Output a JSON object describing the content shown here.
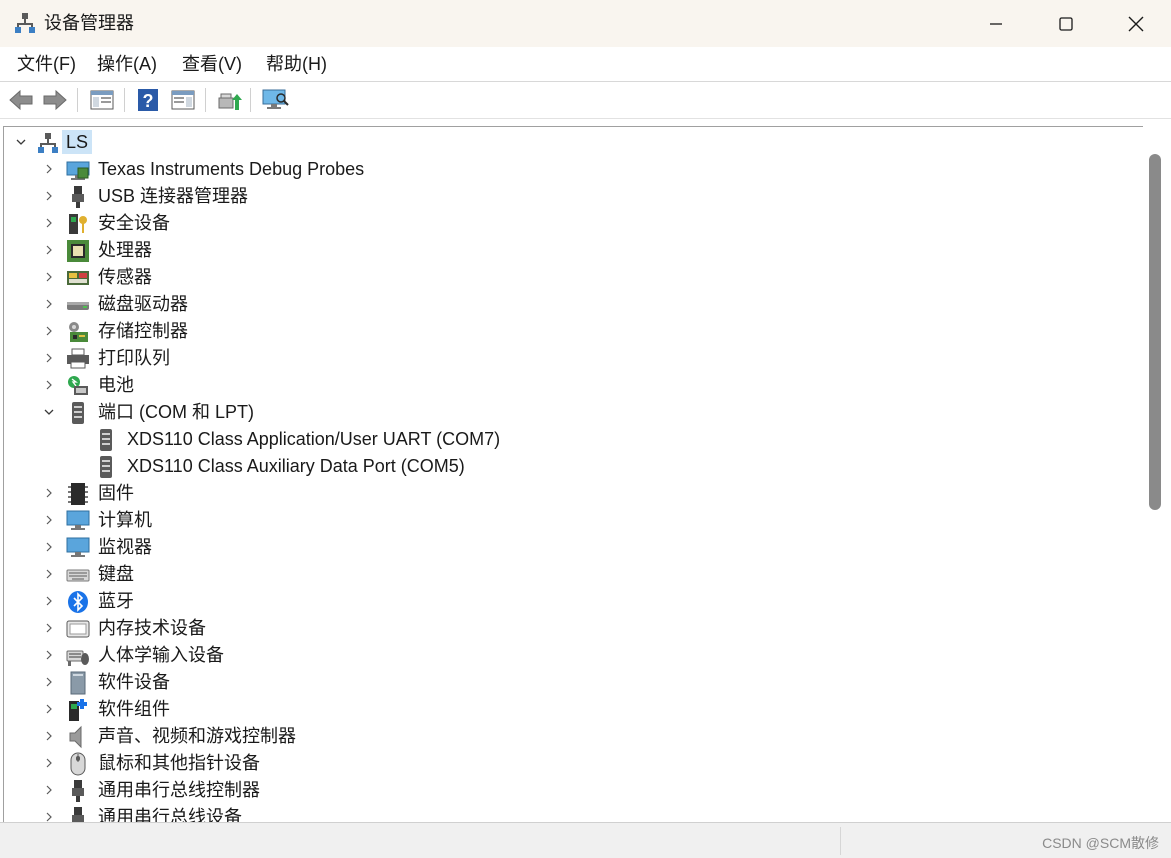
{
  "window": {
    "title": "设备管理器"
  },
  "menu": [
    "文件(F)",
    "操作(A)",
    "查看(V)",
    "帮助(H)"
  ],
  "toolbar": {
    "buttons": [
      "back-icon",
      "forward-icon",
      "show-hide-console-tree-icon",
      "help-icon",
      "properties-icon",
      "update-driver-icon",
      "scan-hardware-icon"
    ]
  },
  "tree": {
    "root": "LS",
    "items": [
      {
        "label": "Texas Instruments Debug Probes",
        "icon": "debug-probe-icon",
        "expanded": false
      },
      {
        "label": "USB 连接器管理器",
        "icon": "usb-connector-icon",
        "expanded": false
      },
      {
        "label": "安全设备",
        "icon": "security-device-icon",
        "expanded": false
      },
      {
        "label": "处理器",
        "icon": "processor-icon",
        "expanded": false
      },
      {
        "label": "传感器",
        "icon": "sensor-icon",
        "expanded": false
      },
      {
        "label": "磁盘驱动器",
        "icon": "disk-drive-icon",
        "expanded": false
      },
      {
        "label": "存储控制器",
        "icon": "storage-controller-icon",
        "expanded": false
      },
      {
        "label": "打印队列",
        "icon": "printer-icon",
        "expanded": false
      },
      {
        "label": "电池",
        "icon": "battery-icon",
        "expanded": false
      },
      {
        "label": "端口 (COM 和 LPT)",
        "icon": "port-icon",
        "expanded": true,
        "children": [
          {
            "label": "XDS110 Class Application/User UART (COM7)",
            "icon": "port-icon"
          },
          {
            "label": "XDS110 Class Auxiliary Data Port (COM5)",
            "icon": "port-icon"
          }
        ]
      },
      {
        "label": "固件",
        "icon": "firmware-icon",
        "expanded": false
      },
      {
        "label": "计算机",
        "icon": "computer-icon",
        "expanded": false
      },
      {
        "label": "监视器",
        "icon": "monitor-icon",
        "expanded": false
      },
      {
        "label": "键盘",
        "icon": "keyboard-icon",
        "expanded": false
      },
      {
        "label": "蓝牙",
        "icon": "bluetooth-icon",
        "expanded": false
      },
      {
        "label": "内存技术设备",
        "icon": "memory-device-icon",
        "expanded": false
      },
      {
        "label": "人体学输入设备",
        "icon": "hid-icon",
        "expanded": false
      },
      {
        "label": "软件设备",
        "icon": "software-device-icon",
        "expanded": false
      },
      {
        "label": "软件组件",
        "icon": "software-component-icon",
        "expanded": false
      },
      {
        "label": "声音、视频和游戏控制器",
        "icon": "speaker-icon",
        "expanded": false
      },
      {
        "label": "鼠标和其他指针设备",
        "icon": "mouse-icon",
        "expanded": false
      },
      {
        "label": "通用串行总线控制器",
        "icon": "usb-controller-icon",
        "expanded": false
      },
      {
        "label": "通用串行总线设备",
        "icon": "usb-device-icon",
        "expanded": false
      }
    ]
  },
  "status": {
    "watermark": "CSDN @SCM散修"
  }
}
